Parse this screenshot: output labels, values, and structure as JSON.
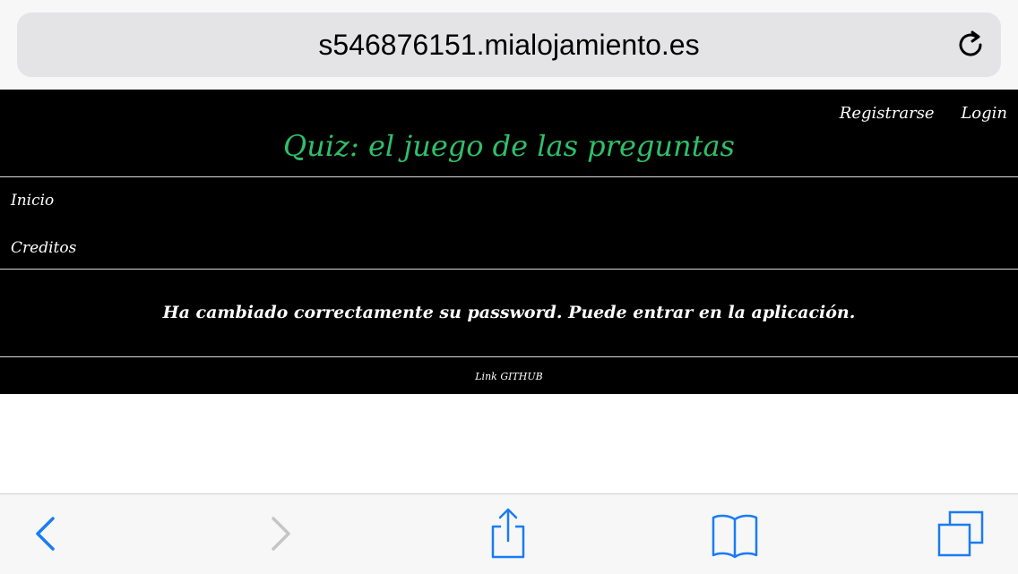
{
  "browser": {
    "url": "s546876151.mialojamiento.es",
    "reload_icon": "reload-icon",
    "accent_color": "#1a7cf5"
  },
  "page": {
    "auth": {
      "register_label": "Registrarse",
      "login_label": "Login"
    },
    "title": "Quiz: el juego de las preguntas",
    "title_color": "#2fbf6a",
    "nav": [
      {
        "label": "Inicio"
      },
      {
        "label": "Creditos"
      }
    ],
    "message": "Ha cambiado correctamente su password. Puede entrar en la aplicación.",
    "footer_link": "Link GITHUB"
  },
  "toolbar": {
    "back_icon": "chevron-left-icon",
    "forward_icon": "chevron-right-icon",
    "share_icon": "share-icon",
    "bookmarks_icon": "book-icon",
    "tabs_icon": "tabs-icon"
  }
}
